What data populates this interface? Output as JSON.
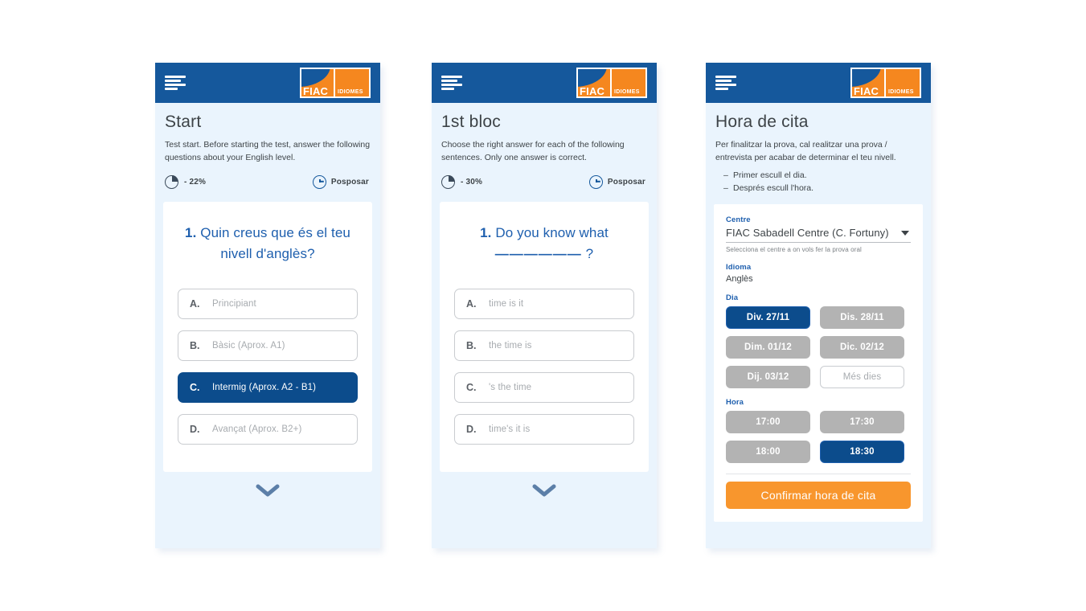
{
  "brand": {
    "logo_primary": "FIAC",
    "logo_secondary": "IDIOMES",
    "header_color": "#15589C",
    "accent_orange": "#F8962D",
    "selected_blue": "#0C4C8C",
    "link_blue": "#1E5FAE"
  },
  "screens": [
    {
      "id": "start",
      "title": "Start",
      "description": "Test start. Before starting the test, answer the following questions about your English level.",
      "progress_label": "- 22%",
      "postpone_label": "Posposar",
      "question": {
        "number": "1.",
        "text": "Quin creus que és el teu nivell d'anglès?",
        "options": [
          {
            "key": "A.",
            "label": "Principiant",
            "selected": false
          },
          {
            "key": "B.",
            "label": "Bàsic (Aprox. A1)",
            "selected": false
          },
          {
            "key": "C.",
            "label": "Intermig (Aprox. A2 - B1)",
            "selected": true
          },
          {
            "key": "D.",
            "label": "Avançat (Aprox. B2+)",
            "selected": false
          }
        ]
      }
    },
    {
      "id": "bloc1",
      "title": "1st bloc",
      "description": "Choose the right answer for each of the following sentences. Only one answer is correct.",
      "progress_label": "- 30%",
      "postpone_label": "Posposar",
      "question": {
        "number": "1.",
        "text": "Do you know what",
        "blank": "——————",
        "suffix": "?",
        "options": [
          {
            "key": "A.",
            "label": "time is it",
            "selected": false
          },
          {
            "key": "B.",
            "label": "the time is",
            "selected": false
          },
          {
            "key": "C.",
            "label": "'s the time",
            "selected": false
          },
          {
            "key": "D.",
            "label": "time's it is",
            "selected": false
          }
        ]
      }
    },
    {
      "id": "appointment",
      "title": "Hora de cita",
      "description": "Per finalitzar la prova, cal realitzar una prova / entrevista per acabar de determinar el teu nivell.",
      "bullets": [
        "Primer escull el dia.",
        "Després escull l'hora."
      ],
      "fields": {
        "centre_label": "Centre",
        "centre_value": "FIAC Sabadell Centre (C. Fortuny)",
        "centre_hint": "Selecciona el centre a on vols fer la prova oral",
        "idioma_label": "Idioma",
        "idioma_value": "Anglès",
        "dia_label": "Dia",
        "hora_label": "Hora"
      },
      "days": [
        {
          "label": "Div. 27/11",
          "state": "selected"
        },
        {
          "label": "Dis. 28/11",
          "state": "available"
        },
        {
          "label": "Dim. 01/12",
          "state": "available"
        },
        {
          "label": "Dic. 02/12",
          "state": "available"
        },
        {
          "label": "Dij. 03/12",
          "state": "available"
        },
        {
          "label": "Més dies",
          "state": "ghost"
        }
      ],
      "times": [
        {
          "label": "17:00",
          "state": "available"
        },
        {
          "label": "17:30",
          "state": "available"
        },
        {
          "label": "18:00",
          "state": "available"
        },
        {
          "label": "18:30",
          "state": "selected"
        }
      ],
      "cta_label": "Confirmar hora de cita"
    }
  ]
}
